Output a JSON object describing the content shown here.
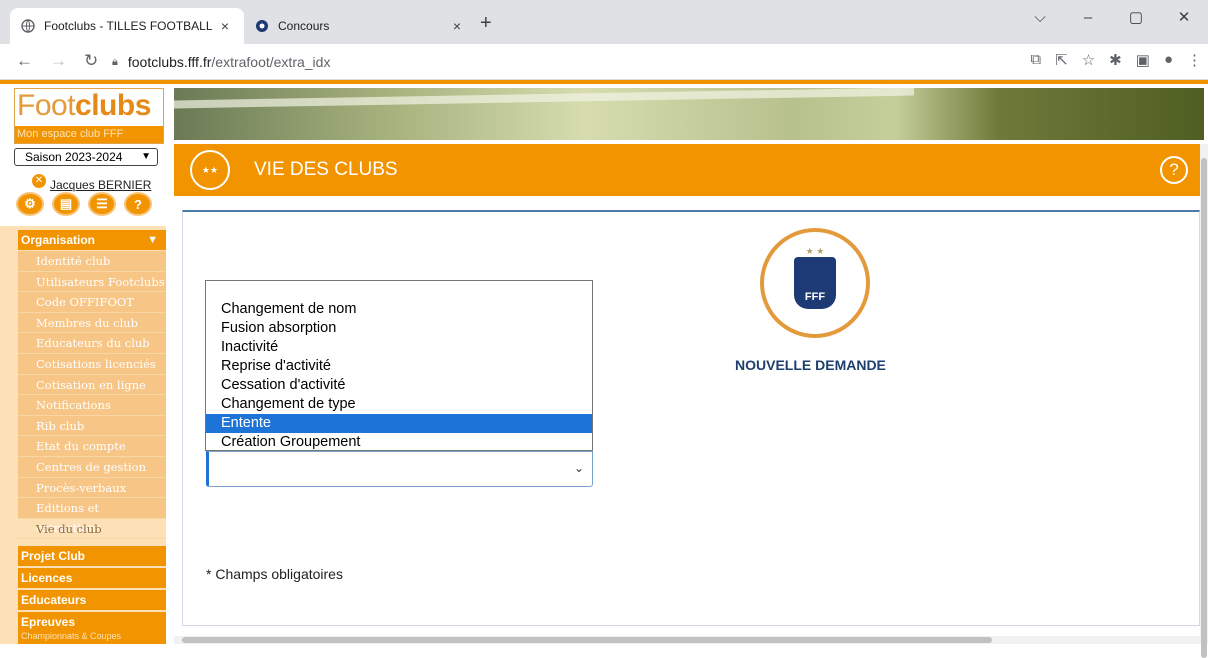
{
  "browser": {
    "tabs": [
      {
        "title": "Footclubs - TILLES FOOTBALL CLU",
        "close": "×"
      },
      {
        "title": "Concours",
        "close": "×"
      }
    ],
    "new_tab": "+",
    "window_controls": [
      "⌵",
      "–",
      "▢",
      "✕"
    ],
    "url_host": "footclubs.fff.fr",
    "url_path": "/extrafoot/extra_idx"
  },
  "sidebar": {
    "logo_a": "Foot",
    "logo_b": "clubs",
    "logo_sub": "Mon espace club FFF",
    "season": "Saison 2023-2024",
    "user": "Jacques BERNIER",
    "icons": [
      "settings-icon",
      "document-icon",
      "list-icon",
      "help-icon"
    ],
    "menu_head": "Organisation",
    "items": [
      "Identité club",
      "Utilisateurs Footclubs",
      "Code OFFIFOOT",
      "Membres du club",
      "Educateurs du club",
      "Cotisations licenciés",
      "Cotisation en ligne",
      "Notifications",
      "Rib club",
      "Etat du compte",
      "Centres de gestion",
      "Procès-verbaux",
      "Editions et extractions",
      "Vie du club"
    ],
    "sections": [
      "Projet Club",
      "Licences",
      "Educateurs",
      "Epreuves"
    ],
    "epreuves_sub": "Championnats & Coupes"
  },
  "header": {
    "title": "VIE DES CLUBS",
    "help": "?"
  },
  "main": {
    "new_request": "NOUVELLE DEMANDE",
    "dropdown_options": [
      "Changement de nom",
      "Fusion absorption",
      "Inactivité",
      "Reprise d'activité",
      "Cessation d'activité",
      "Changement de type",
      "Entente",
      "Création Groupement"
    ],
    "highlighted_option": "Entente",
    "required_note": "* Champs obligatoires"
  },
  "colors": {
    "accent": "#f29400",
    "highlight": "#1e74d6",
    "title_blue": "#1e3f6e"
  }
}
